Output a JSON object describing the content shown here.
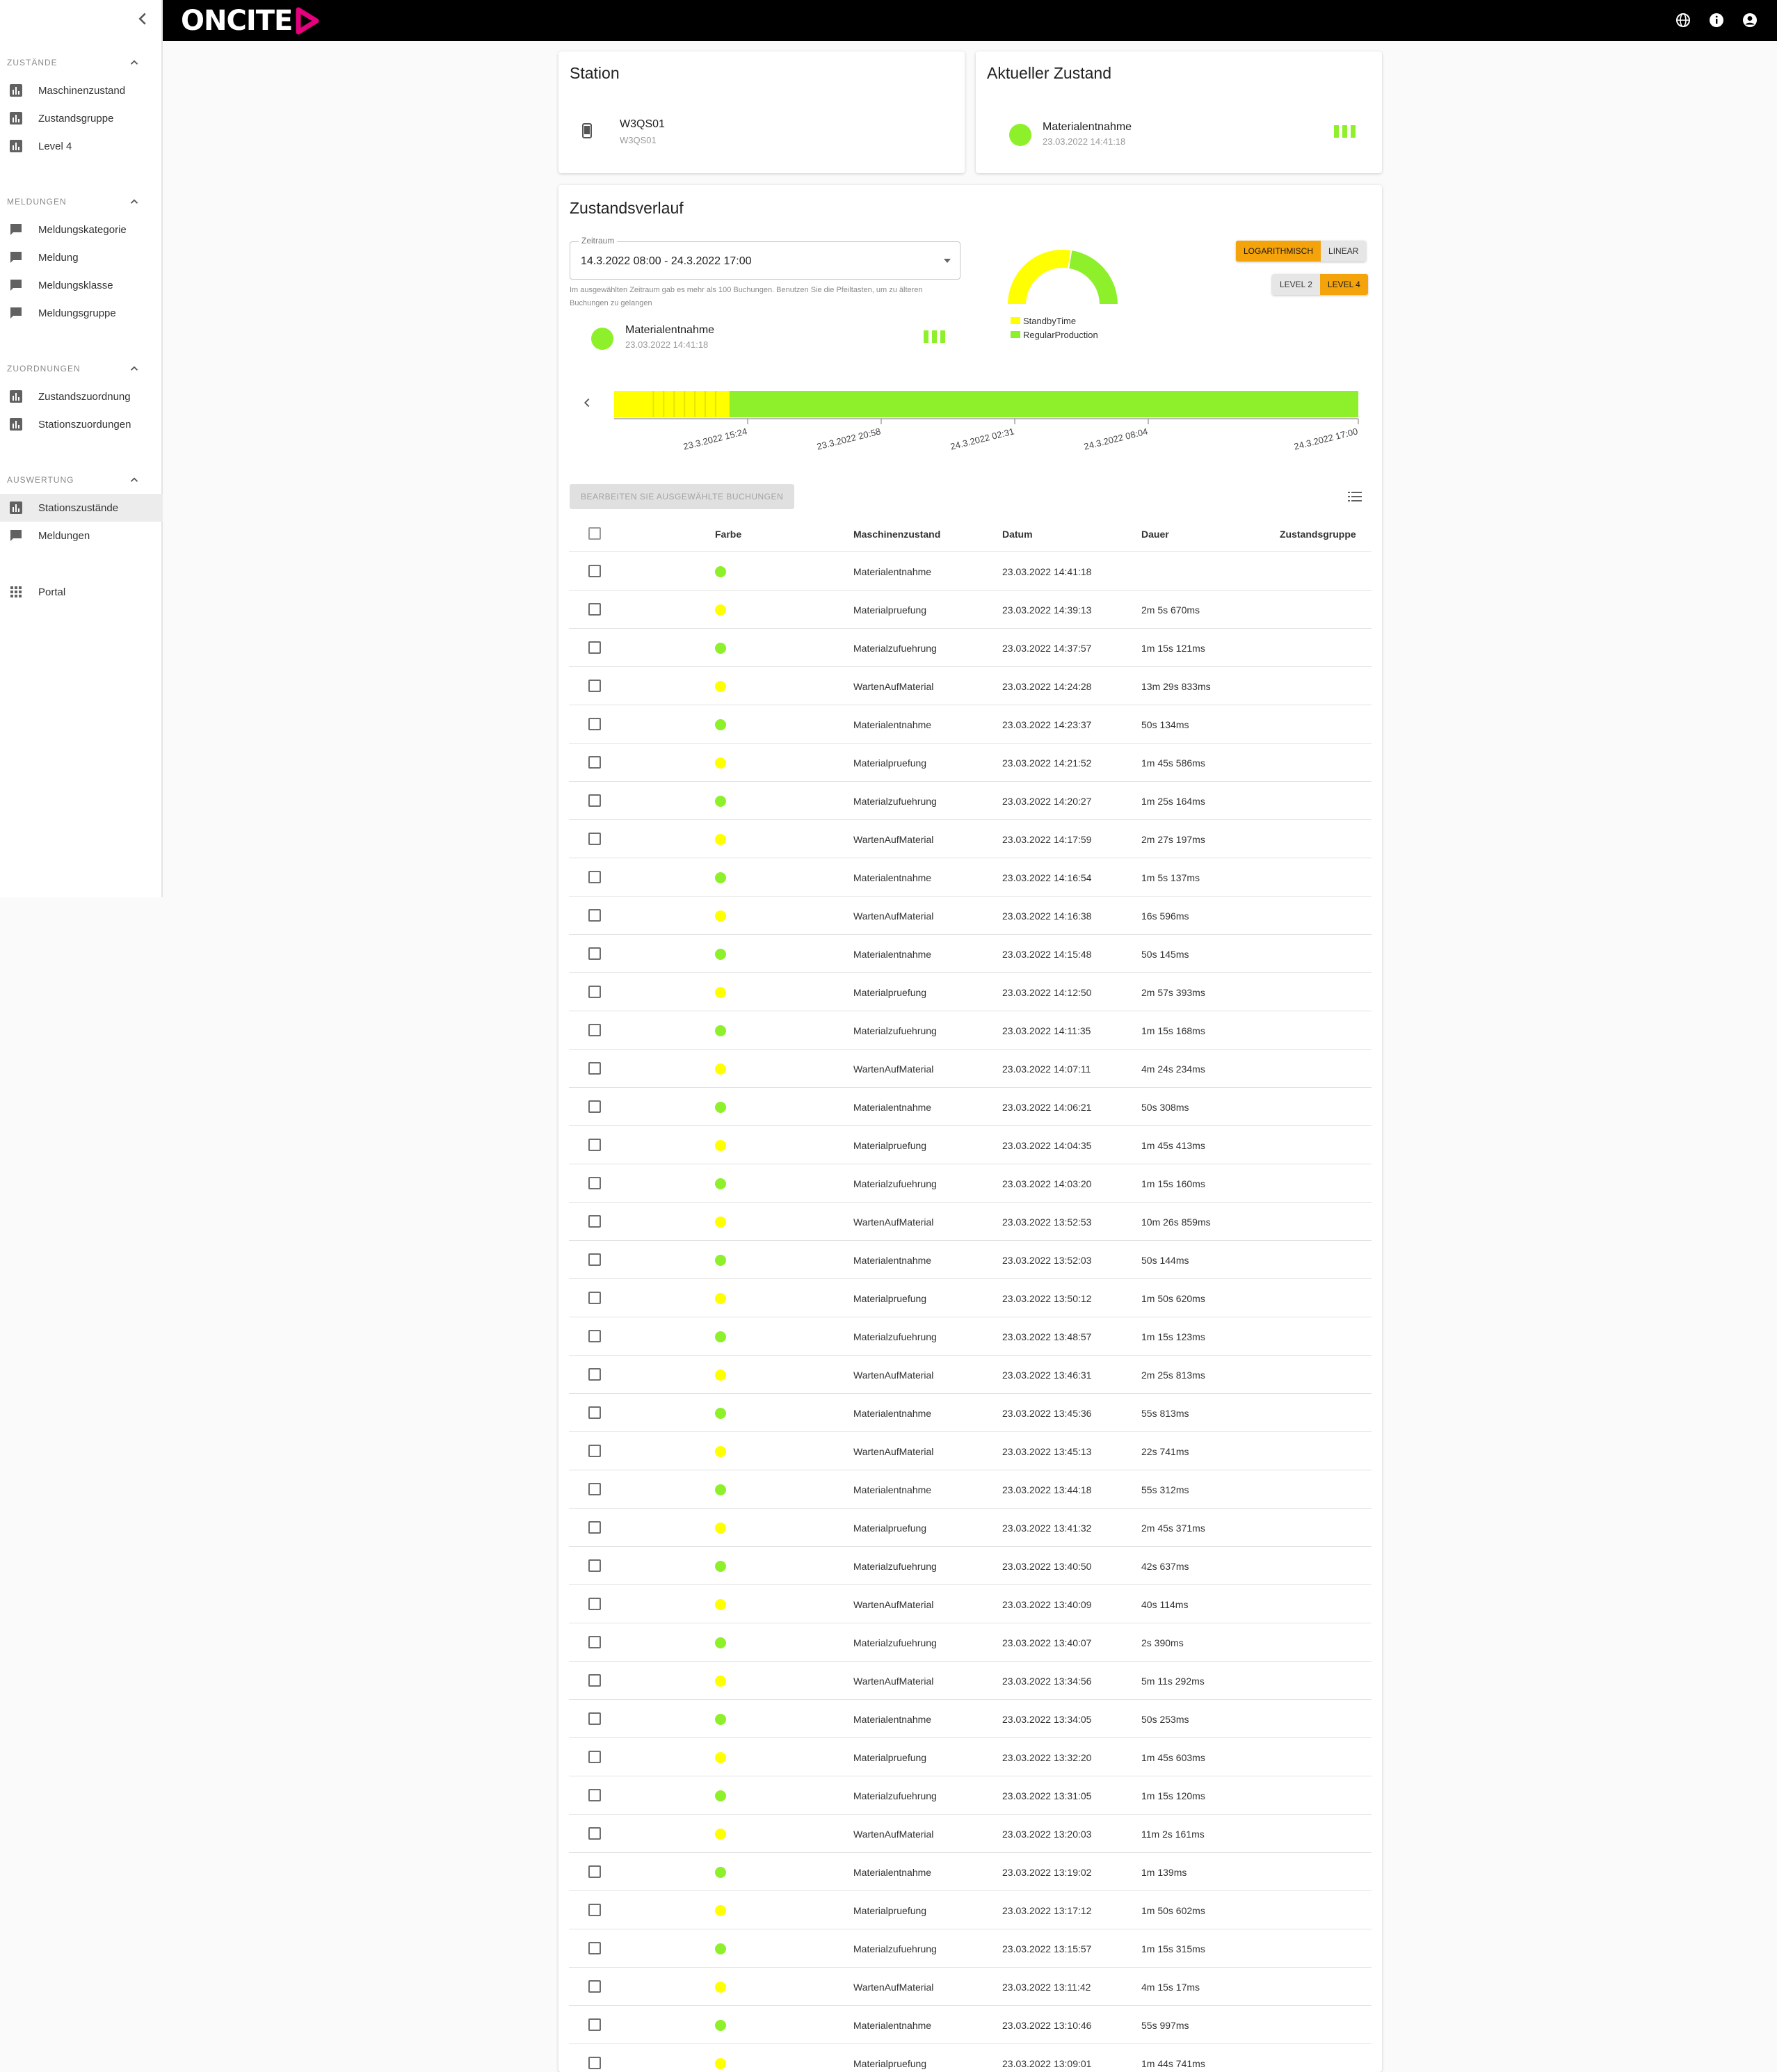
{
  "app": {
    "logo_text": "ONCITE"
  },
  "header": {
    "icons": [
      "globe-icon",
      "info-icon",
      "account-icon"
    ]
  },
  "sidebar": {
    "sections": [
      {
        "title": "ZUSTÄNDE",
        "items": [
          {
            "label": "Maschinenzustand",
            "icon": "chart-icon"
          },
          {
            "label": "Zustandsgruppe",
            "icon": "chart-icon"
          },
          {
            "label": "Level 4",
            "icon": "chart-icon"
          }
        ]
      },
      {
        "title": "MELDUNGEN",
        "items": [
          {
            "label": "Meldungskategorie",
            "icon": "message-icon"
          },
          {
            "label": "Meldung",
            "icon": "message-icon"
          },
          {
            "label": "Meldungsklasse",
            "icon": "message-icon"
          },
          {
            "label": "Meldungsgruppe",
            "icon": "message-icon"
          }
        ]
      },
      {
        "title": "ZUORDNUNGEN",
        "items": [
          {
            "label": "Zustandszuordnung",
            "icon": "chart-icon"
          },
          {
            "label": "Stationszuordungen",
            "icon": "chart-icon"
          }
        ]
      },
      {
        "title": "AUSWERTUNG",
        "items": [
          {
            "label": "Stationszustände",
            "icon": "chart-icon",
            "active": true
          },
          {
            "label": "Meldungen",
            "icon": "message-icon"
          }
        ]
      }
    ],
    "portal_label": "Portal"
  },
  "station_card": {
    "title": "Station",
    "name": "W3QS01",
    "sub": "W3QS01"
  },
  "current_card": {
    "title": "Aktueller Zustand",
    "state": "Materialentnahme",
    "time": "23.03.2022 14:41:18"
  },
  "history": {
    "title": "Zustandsverlauf",
    "range_label": "Zeitraum",
    "range_value": "14.3.2022 08:00 - 24.3.2022 17:00",
    "hint": "Im ausgewählten Zeitraum gab es mehr als 100 Buchungen. Benutzen Sie die Pfeiltasten, um zu älteren Buchungen zu gelangen",
    "selected_state": "Materialentnahme",
    "selected_time": "23.03.2022 14:41:18",
    "scale_toggle": {
      "options": [
        "LOGARITHMISCH",
        "LINEAR"
      ],
      "selected": "LOGARITHMISCH"
    },
    "level_toggle": {
      "options": [
        "LEVEL 2",
        "LEVEL 4"
      ],
      "selected": "LEVEL 4"
    },
    "edit_button": "BEARBEITEN SIE AUSGEWÄHLTE BUCHUNGEN"
  },
  "chart_data": {
    "type": "pie",
    "variant": "half-donut",
    "series": [
      {
        "name": "StandbyTime",
        "color": "#ffff00",
        "value": 55
      },
      {
        "name": "RegularProduction",
        "color": "#8ef02b",
        "value": 45
      }
    ],
    "timeline": {
      "ticks": [
        "23.3.2022 15:24",
        "23.3.2022 20:58",
        "24.3.2022 02:31",
        "24.3.2022 08:04",
        "24.3.2022 17:00"
      ],
      "segments": [
        {
          "state": "StandbyTime",
          "fraction": 0.155
        },
        {
          "state": "RegularProduction",
          "fraction": 0.845
        }
      ]
    }
  },
  "colors": {
    "green": "#8ef02b",
    "yellow": "#ffff00",
    "accent": "#f5a30a",
    "brand_pink": "#e5007d"
  },
  "table": {
    "columns": [
      "Farbe",
      "Maschinenzustand",
      "Datum",
      "Dauer",
      "Zustandsgruppe"
    ],
    "rows": [
      {
        "color": "green",
        "state": "Materialentnahme",
        "date": "23.03.2022 14:41:18",
        "duration": ""
      },
      {
        "color": "yellow",
        "state": "Materialpruefung",
        "date": "23.03.2022 14:39:13",
        "duration": "2m 5s 670ms"
      },
      {
        "color": "green",
        "state": "Materialzufuehrung",
        "date": "23.03.2022 14:37:57",
        "duration": "1m 15s 121ms"
      },
      {
        "color": "yellow",
        "state": "WartenAufMaterial",
        "date": "23.03.2022 14:24:28",
        "duration": "13m 29s 833ms"
      },
      {
        "color": "green",
        "state": "Materialentnahme",
        "date": "23.03.2022 14:23:37",
        "duration": "50s 134ms"
      },
      {
        "color": "yellow",
        "state": "Materialpruefung",
        "date": "23.03.2022 14:21:52",
        "duration": "1m 45s 586ms"
      },
      {
        "color": "green",
        "state": "Materialzufuehrung",
        "date": "23.03.2022 14:20:27",
        "duration": "1m 25s 164ms"
      },
      {
        "color": "yellow",
        "state": "WartenAufMaterial",
        "date": "23.03.2022 14:17:59",
        "duration": "2m 27s 197ms"
      },
      {
        "color": "green",
        "state": "Materialentnahme",
        "date": "23.03.2022 14:16:54",
        "duration": "1m 5s 137ms"
      },
      {
        "color": "yellow",
        "state": "WartenAufMaterial",
        "date": "23.03.2022 14:16:38",
        "duration": "16s 596ms"
      },
      {
        "color": "green",
        "state": "Materialentnahme",
        "date": "23.03.2022 14:15:48",
        "duration": "50s 145ms"
      },
      {
        "color": "yellow",
        "state": "Materialpruefung",
        "date": "23.03.2022 14:12:50",
        "duration": "2m 57s 393ms"
      },
      {
        "color": "green",
        "state": "Materialzufuehrung",
        "date": "23.03.2022 14:11:35",
        "duration": "1m 15s 168ms"
      },
      {
        "color": "yellow",
        "state": "WartenAufMaterial",
        "date": "23.03.2022 14:07:11",
        "duration": "4m 24s 234ms"
      },
      {
        "color": "green",
        "state": "Materialentnahme",
        "date": "23.03.2022 14:06:21",
        "duration": "50s 308ms"
      },
      {
        "color": "yellow",
        "state": "Materialpruefung",
        "date": "23.03.2022 14:04:35",
        "duration": "1m 45s 413ms"
      },
      {
        "color": "green",
        "state": "Materialzufuehrung",
        "date": "23.03.2022 14:03:20",
        "duration": "1m 15s 160ms"
      },
      {
        "color": "yellow",
        "state": "WartenAufMaterial",
        "date": "23.03.2022 13:52:53",
        "duration": "10m 26s 859ms"
      },
      {
        "color": "green",
        "state": "Materialentnahme",
        "date": "23.03.2022 13:52:03",
        "duration": "50s 144ms"
      },
      {
        "color": "yellow",
        "state": "Materialpruefung",
        "date": "23.03.2022 13:50:12",
        "duration": "1m 50s 620ms"
      },
      {
        "color": "green",
        "state": "Materialzufuehrung",
        "date": "23.03.2022 13:48:57",
        "duration": "1m 15s 123ms"
      },
      {
        "color": "yellow",
        "state": "WartenAufMaterial",
        "date": "23.03.2022 13:46:31",
        "duration": "2m 25s 813ms"
      },
      {
        "color": "green",
        "state": "Materialentnahme",
        "date": "23.03.2022 13:45:36",
        "duration": "55s 813ms"
      },
      {
        "color": "yellow",
        "state": "WartenAufMaterial",
        "date": "23.03.2022 13:45:13",
        "duration": "22s 741ms"
      },
      {
        "color": "green",
        "state": "Materialentnahme",
        "date": "23.03.2022 13:44:18",
        "duration": "55s 312ms"
      },
      {
        "color": "yellow",
        "state": "Materialpruefung",
        "date": "23.03.2022 13:41:32",
        "duration": "2m 45s 371ms"
      },
      {
        "color": "green",
        "state": "Materialzufuehrung",
        "date": "23.03.2022 13:40:50",
        "duration": "42s 637ms"
      },
      {
        "color": "yellow",
        "state": "WartenAufMaterial",
        "date": "23.03.2022 13:40:09",
        "duration": "40s 114ms"
      },
      {
        "color": "green",
        "state": "Materialzufuehrung",
        "date": "23.03.2022 13:40:07",
        "duration": "2s 390ms"
      },
      {
        "color": "yellow",
        "state": "WartenAufMaterial",
        "date": "23.03.2022 13:34:56",
        "duration": "5m 11s 292ms"
      },
      {
        "color": "green",
        "state": "Materialentnahme",
        "date": "23.03.2022 13:34:05",
        "duration": "50s 253ms"
      },
      {
        "color": "yellow",
        "state": "Materialpruefung",
        "date": "23.03.2022 13:32:20",
        "duration": "1m 45s 603ms"
      },
      {
        "color": "green",
        "state": "Materialzufuehrung",
        "date": "23.03.2022 13:31:05",
        "duration": "1m 15s 120ms"
      },
      {
        "color": "yellow",
        "state": "WartenAufMaterial",
        "date": "23.03.2022 13:20:03",
        "duration": "11m 2s 161ms"
      },
      {
        "color": "green",
        "state": "Materialentnahme",
        "date": "23.03.2022 13:19:02",
        "duration": "1m 139ms"
      },
      {
        "color": "yellow",
        "state": "Materialpruefung",
        "date": "23.03.2022 13:17:12",
        "duration": "1m 50s 602ms"
      },
      {
        "color": "green",
        "state": "Materialzufuehrung",
        "date": "23.03.2022 13:15:57",
        "duration": "1m 15s 315ms"
      },
      {
        "color": "yellow",
        "state": "WartenAufMaterial",
        "date": "23.03.2022 13:11:42",
        "duration": "4m 15s 17ms"
      },
      {
        "color": "green",
        "state": "Materialentnahme",
        "date": "23.03.2022 13:10:46",
        "duration": "55s 997ms"
      },
      {
        "color": "yellow",
        "state": "Materialpruefung",
        "date": "23.03.2022 13:09:01",
        "duration": "1m 44s 741ms"
      }
    ]
  }
}
